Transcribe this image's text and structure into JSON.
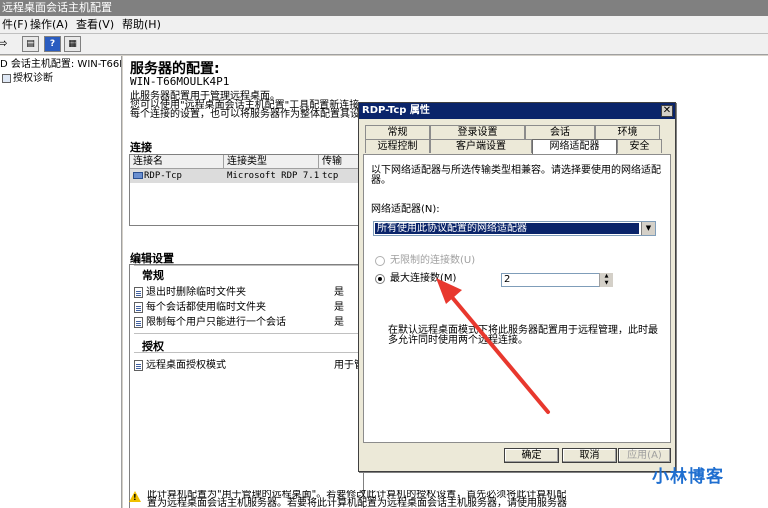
{
  "window": {
    "title": "远程桌面会话主机配置"
  },
  "menu": [
    "件(F)",
    "操作(A)",
    "查看(V)",
    "帮助(H)"
  ],
  "toolbar": [
    "back",
    "forward",
    "console",
    "help",
    "properties"
  ],
  "tree": {
    "items": [
      {
        "label": "D 会话主机配置: WIN-T66M"
      },
      {
        "label": "授权诊断"
      }
    ]
  },
  "main": {
    "title": "服务器的配置:",
    "server": "WIN-T66MOULK4P1",
    "desc": [
      "此服务器配置用于管理远程桌面。",
      "您可以使用\"远程桌面会话主机配置\"工具配置新连接",
      "每个连接的设置，也可以将服务器作为整体配置其设置"
    ],
    "connections_head": "连接",
    "columns": [
      "连接名",
      "连接类型",
      "传输"
    ],
    "rows": [
      {
        "name": "RDP-Tcp",
        "type": "Microsoft RDP 7.1",
        "transport": "tcp"
      }
    ],
    "edit_head": "编辑设置",
    "general_head": "常规",
    "general_items": [
      {
        "label": "退出时删除临时文件夹",
        "value": "是"
      },
      {
        "label": "每个会话都使用临时文件夹",
        "value": "是"
      },
      {
        "label": "限制每个用户只能进行一个会话",
        "value": "是"
      }
    ],
    "license_head": "授权",
    "license_items": [
      {
        "label": "远程桌面授权模式",
        "value": "用于管"
      }
    ],
    "warning": [
      "此计算机配置为\"用于管理的远程桌面\"。若要修改此计算机的授权设置，首先必须将此计算机配",
      "置为远程桌面会话主机服务器。若要将此计算机配置为远程桌面会话主机服务器，请使用服务器"
    ]
  },
  "dialog": {
    "title": "RDP-Tcp 属性",
    "close": "✕",
    "tabs_row1": [
      "常规",
      "登录设置",
      "会话",
      "环境"
    ],
    "tabs_row2": [
      "远程控制",
      "客户端设置",
      "网络适配器",
      "安全"
    ],
    "intro": [
      "以下网络适配器与所选传输类型相兼容。请选择要使用的网络适配",
      "器。"
    ],
    "adapter_label": "网络适配器(N):",
    "adapter_value": "所有使用此协议配置的网络适配器",
    "unlimited_label": "无限制的连接数(U)",
    "max_label": "最大连接数(M)",
    "max_value": "2",
    "note": [
      "在默认远程桌面模式下将此服务器配置用于远程管理，此时最",
      "多允许同时使用两个远程连接。"
    ],
    "buttons": {
      "ok": "确定",
      "cancel": "取消",
      "apply": "应用(A)"
    }
  },
  "watermark": "小林博客",
  "colors": {
    "selection": "#0a246a",
    "annotation": "#e8382e",
    "watermark": "#1f6fd0"
  }
}
